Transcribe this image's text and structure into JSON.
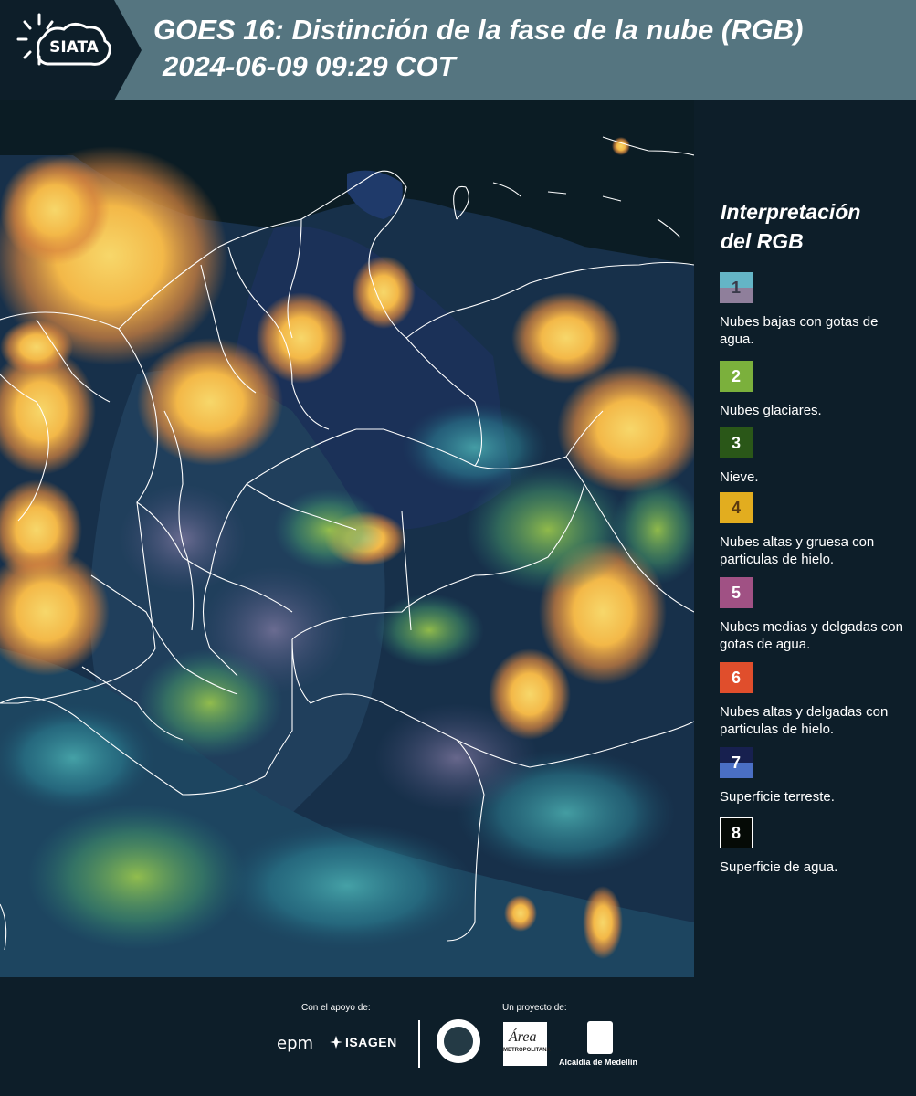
{
  "header": {
    "logo_text": "SIATA",
    "title": "GOES 16: Distinción de la fase de la nube (RGB)",
    "subtitle": "2024-06-09 09:29 COT"
  },
  "legend": {
    "title_line1": "Interpretación",
    "title_line2": "del RGB",
    "items": [
      {
        "num": "1",
        "color_top": "#64b5c6",
        "color_bottom": "#8f7f9b",
        "desc": "Nubes bajas con gotas de agua."
      },
      {
        "num": "2",
        "color": "#7bb03c",
        "desc": "Nubes glaciares."
      },
      {
        "num": "3",
        "color": "#2a5718",
        "desc": "Nieve."
      },
      {
        "num": "4",
        "color": "#e2ad1f",
        "desc": "Nubes altas y gruesa con particulas de hielo."
      },
      {
        "num": "5",
        "color": "#a05184",
        "desc": "Nubes medias y delgadas con gotas de agua."
      },
      {
        "num": "6",
        "color": "#e04e2c",
        "desc": "Nubes altas y delgadas con particulas de hielo."
      },
      {
        "num": "7",
        "color_top": "#17204f",
        "color_bottom": "#4a6fc4",
        "desc": "Superficie terreste."
      },
      {
        "num": "8",
        "color": "#050a06",
        "desc": "Superficie de agua."
      }
    ]
  },
  "footer": {
    "support_label": "Con el apoyo de:",
    "project_label": "Un proyecto de:",
    "epm": "epm",
    "isagen": "ISAGEN",
    "metro_area": "Área",
    "metro_text": "METROPOLITANA",
    "alcaldia": "Alcaldía de Medellín"
  }
}
